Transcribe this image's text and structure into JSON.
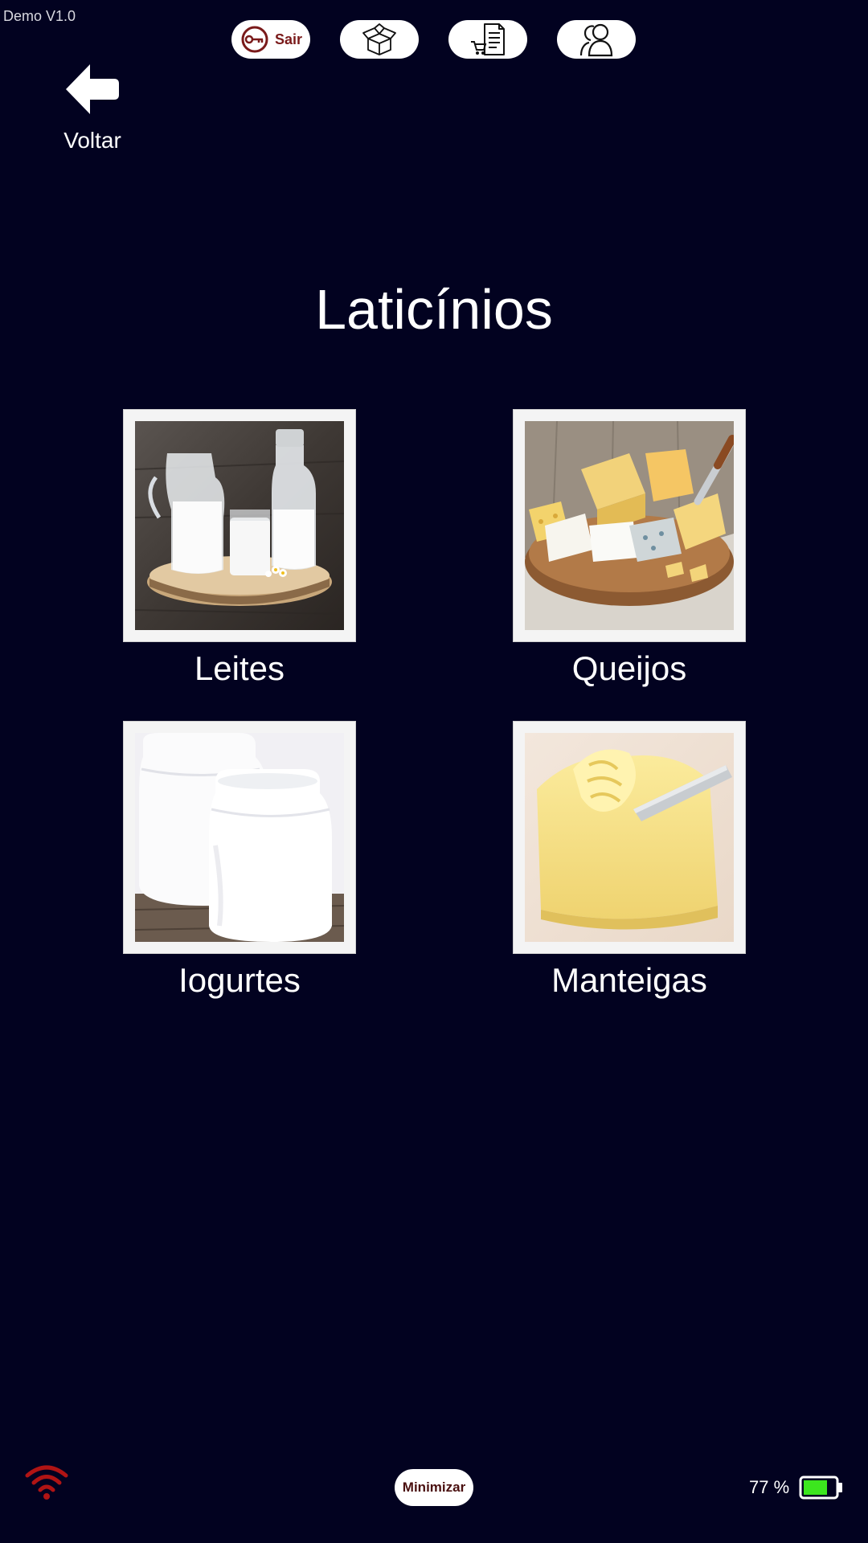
{
  "app": {
    "version_label": "Demo V1.0"
  },
  "top_bar": {
    "logout_label": "Sair",
    "icons": [
      "key-icon",
      "box-icon",
      "cart-document-icon",
      "users-icon"
    ]
  },
  "back": {
    "label": "Voltar",
    "icon": "arrow-left-icon"
  },
  "page": {
    "title": "Laticínios"
  },
  "categories": [
    {
      "label": "Leites",
      "image": "milk-jugs-photo"
    },
    {
      "label": "Queijos",
      "image": "cheese-board-photo"
    },
    {
      "label": "Iogurtes",
      "image": "yogurt-jars-photo"
    },
    {
      "label": "Manteigas",
      "image": "butter-knife-photo"
    }
  ],
  "bottom_bar": {
    "minimize_label": "Minimizar",
    "battery_text": "77 %",
    "battery_level": 0.77,
    "wifi_status": "disconnected",
    "colors": {
      "wifi": "#b01414",
      "battery_fill": "#3ce61e"
    }
  },
  "colors": {
    "background": "#020220",
    "tile_frame": "#f4f4f4"
  }
}
